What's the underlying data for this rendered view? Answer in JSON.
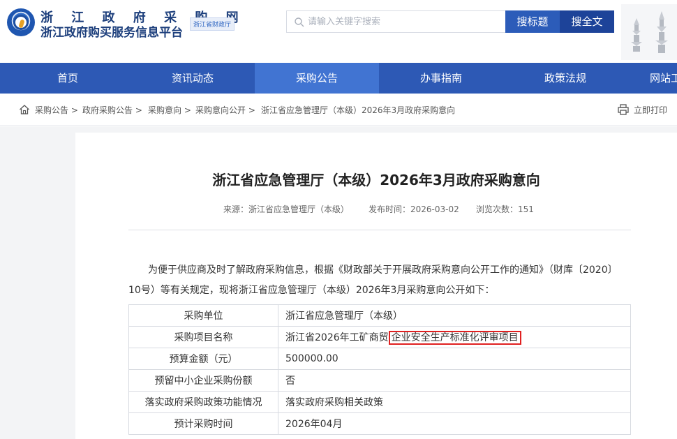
{
  "header": {
    "title_line1": "浙 江 政 府 采 购 网",
    "title_line2": "浙江政府购买服务信息平台",
    "tag": "浙江省财政厅",
    "search_placeholder": "请输入关键字搜索",
    "btn_search_title": "搜标题",
    "btn_search_full": "搜全文"
  },
  "nav": {
    "items": [
      {
        "label": "首页"
      },
      {
        "label": "资讯动态"
      },
      {
        "label": "采购公告"
      },
      {
        "label": "办事指南"
      },
      {
        "label": "政策法规"
      },
      {
        "label": "网站工"
      }
    ],
    "active_index": 2
  },
  "breadcrumb": {
    "items": [
      "采购公告 >",
      "政府采购公告 >",
      "采购意向 >",
      "采购意向公开 >",
      "浙江省应急管理厅（本级）2026年3月政府采购意向"
    ],
    "print_label": "立即打印"
  },
  "article": {
    "title": "浙江省应急管理厅（本级）2026年3月政府采购意向",
    "source": "来源：浙江省应急管理厅（本级）",
    "publish_time": "发布时间：2026-03-02",
    "views": "浏览次数：151",
    "para_line1": "为便于供应商及时了解政府采购信息，根据《财政部关于开展政府采购意向公开工作的通知》（财库〔2020〕",
    "para_line2": "10号）等有关规定，现将浙江省应急管理厅（本级）2026年3月采购意向公开如下：",
    "table": [
      {
        "k": "采购单位",
        "v": "浙江省应急管理厅（本级）"
      },
      {
        "k": "采购项目名称",
        "v_pre": "浙江省2026年工矿商贸",
        "v_hl": "企业安全生产标准化评审项目"
      },
      {
        "k": "预算金额（元）",
        "v": "500000.00"
      },
      {
        "k": "预留中小企业采购份额",
        "v": "否"
      },
      {
        "k": "落实政府采购政策功能情况",
        "v": "落实政府采购相关政策"
      },
      {
        "k": "预计采购时间",
        "v": "2026年04月"
      }
    ]
  },
  "colors": {
    "nav_bg": "#2d59b5",
    "nav_active": "#4174d2",
    "highlight_border": "#e02020"
  }
}
